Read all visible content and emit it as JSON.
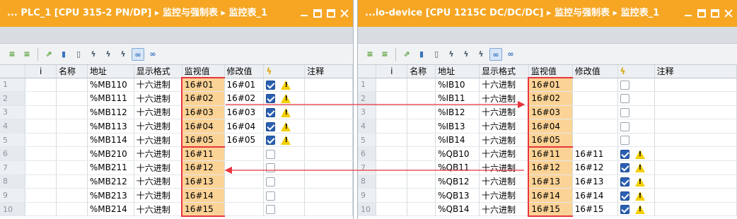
{
  "colors": {
    "accent": "#f6a623",
    "highlight": "#fcd396",
    "arrow": "#e8343d"
  },
  "left": {
    "title": "... PLC_1 [CPU 315-2 PN/DP] ▸ 监控与强制表 ▸ 监控表_1",
    "columns": [
      "",
      "i",
      "名称",
      "地址",
      "显示格式",
      "监视值",
      "修改值",
      "",
      "注释"
    ],
    "rows": [
      {
        "num": "1",
        "address": "%MB110",
        "format": "十六进制",
        "monitor": "16#01",
        "modify": "16#01",
        "checked": true,
        "warn": true
      },
      {
        "num": "2",
        "address": "%MB111",
        "format": "十六进制",
        "monitor": "16#02",
        "modify": "16#02",
        "checked": true,
        "warn": true
      },
      {
        "num": "3",
        "address": "%MB112",
        "format": "十六进制",
        "monitor": "16#03",
        "modify": "16#03",
        "checked": true,
        "warn": true
      },
      {
        "num": "4",
        "address": "%MB113",
        "format": "十六进制",
        "monitor": "16#04",
        "modify": "16#04",
        "checked": true,
        "warn": true
      },
      {
        "num": "5",
        "address": "%MB114",
        "format": "十六进制",
        "monitor": "16#05",
        "modify": "16#05",
        "checked": true,
        "warn": true
      },
      {
        "num": "6",
        "address": "%MB210",
        "format": "十六进制",
        "monitor": "16#11",
        "modify": "",
        "checked": false,
        "warn": false
      },
      {
        "num": "7",
        "address": "%MB211",
        "format": "十六进制",
        "monitor": "16#12",
        "modify": "",
        "checked": false,
        "warn": false
      },
      {
        "num": "8",
        "address": "%MB212",
        "format": "十六进制",
        "monitor": "16#13",
        "modify": "",
        "checked": false,
        "warn": false
      },
      {
        "num": "9",
        "address": "%MB213",
        "format": "十六进制",
        "monitor": "16#14",
        "modify": "",
        "checked": false,
        "warn": false
      },
      {
        "num": "10",
        "address": "%MB214",
        "format": "十六进制",
        "monitor": "16#15",
        "modify": "",
        "checked": false,
        "warn": false
      }
    ]
  },
  "right": {
    "title": "...io-device [CPU 1215C DC/DC/DC] ▸ 监控与强制表 ▸ 监控表_1",
    "columns": [
      "",
      "i",
      "名称",
      "地址",
      "显示格式",
      "监视值",
      "修改值",
      "",
      "注释"
    ],
    "rows": [
      {
        "num": "1",
        "address": "%IB10",
        "format": "十六进制",
        "monitor": "16#01",
        "modify": "",
        "checked": false,
        "warn": false
      },
      {
        "num": "2",
        "address": "%IB11",
        "format": "十六进制",
        "monitor": "16#02",
        "modify": "",
        "checked": false,
        "warn": false
      },
      {
        "num": "3",
        "address": "%IB12",
        "format": "十六进制",
        "monitor": "16#03",
        "modify": "",
        "checked": false,
        "warn": false
      },
      {
        "num": "4",
        "address": "%IB13",
        "format": "十六进制",
        "monitor": "16#04",
        "modify": "",
        "checked": false,
        "warn": false
      },
      {
        "num": "5",
        "address": "%IB14",
        "format": "十六进制",
        "monitor": "16#05",
        "modify": "",
        "checked": false,
        "warn": false
      },
      {
        "num": "6",
        "address": "%QB10",
        "format": "十六进制",
        "monitor": "16#11",
        "modify": "16#11",
        "checked": true,
        "warn": true
      },
      {
        "num": "7",
        "address": "%QB11",
        "format": "十六进制",
        "monitor": "16#12",
        "modify": "16#12",
        "checked": true,
        "warn": true
      },
      {
        "num": "8",
        "address": "%QB12",
        "format": "十六进制",
        "monitor": "16#13",
        "modify": "16#13",
        "checked": true,
        "warn": true
      },
      {
        "num": "9",
        "address": "%QB13",
        "format": "十六进制",
        "monitor": "16#14",
        "modify": "16#14",
        "checked": true,
        "warn": true
      },
      {
        "num": "10",
        "address": "%QB14",
        "format": "十六进制",
        "monitor": "16#15",
        "modify": "16#15",
        "checked": true,
        "warn": true
      }
    ]
  },
  "toolbar_icons": [
    "insert-row-icon",
    "add-row-icon",
    "force-icon",
    "modify-now-icon",
    "modify-trigger-icon",
    "lightning-1-icon",
    "lightning-percent-icon",
    "lightning-check-icon",
    "monitor-all-icon",
    "monitor-once-icon"
  ]
}
